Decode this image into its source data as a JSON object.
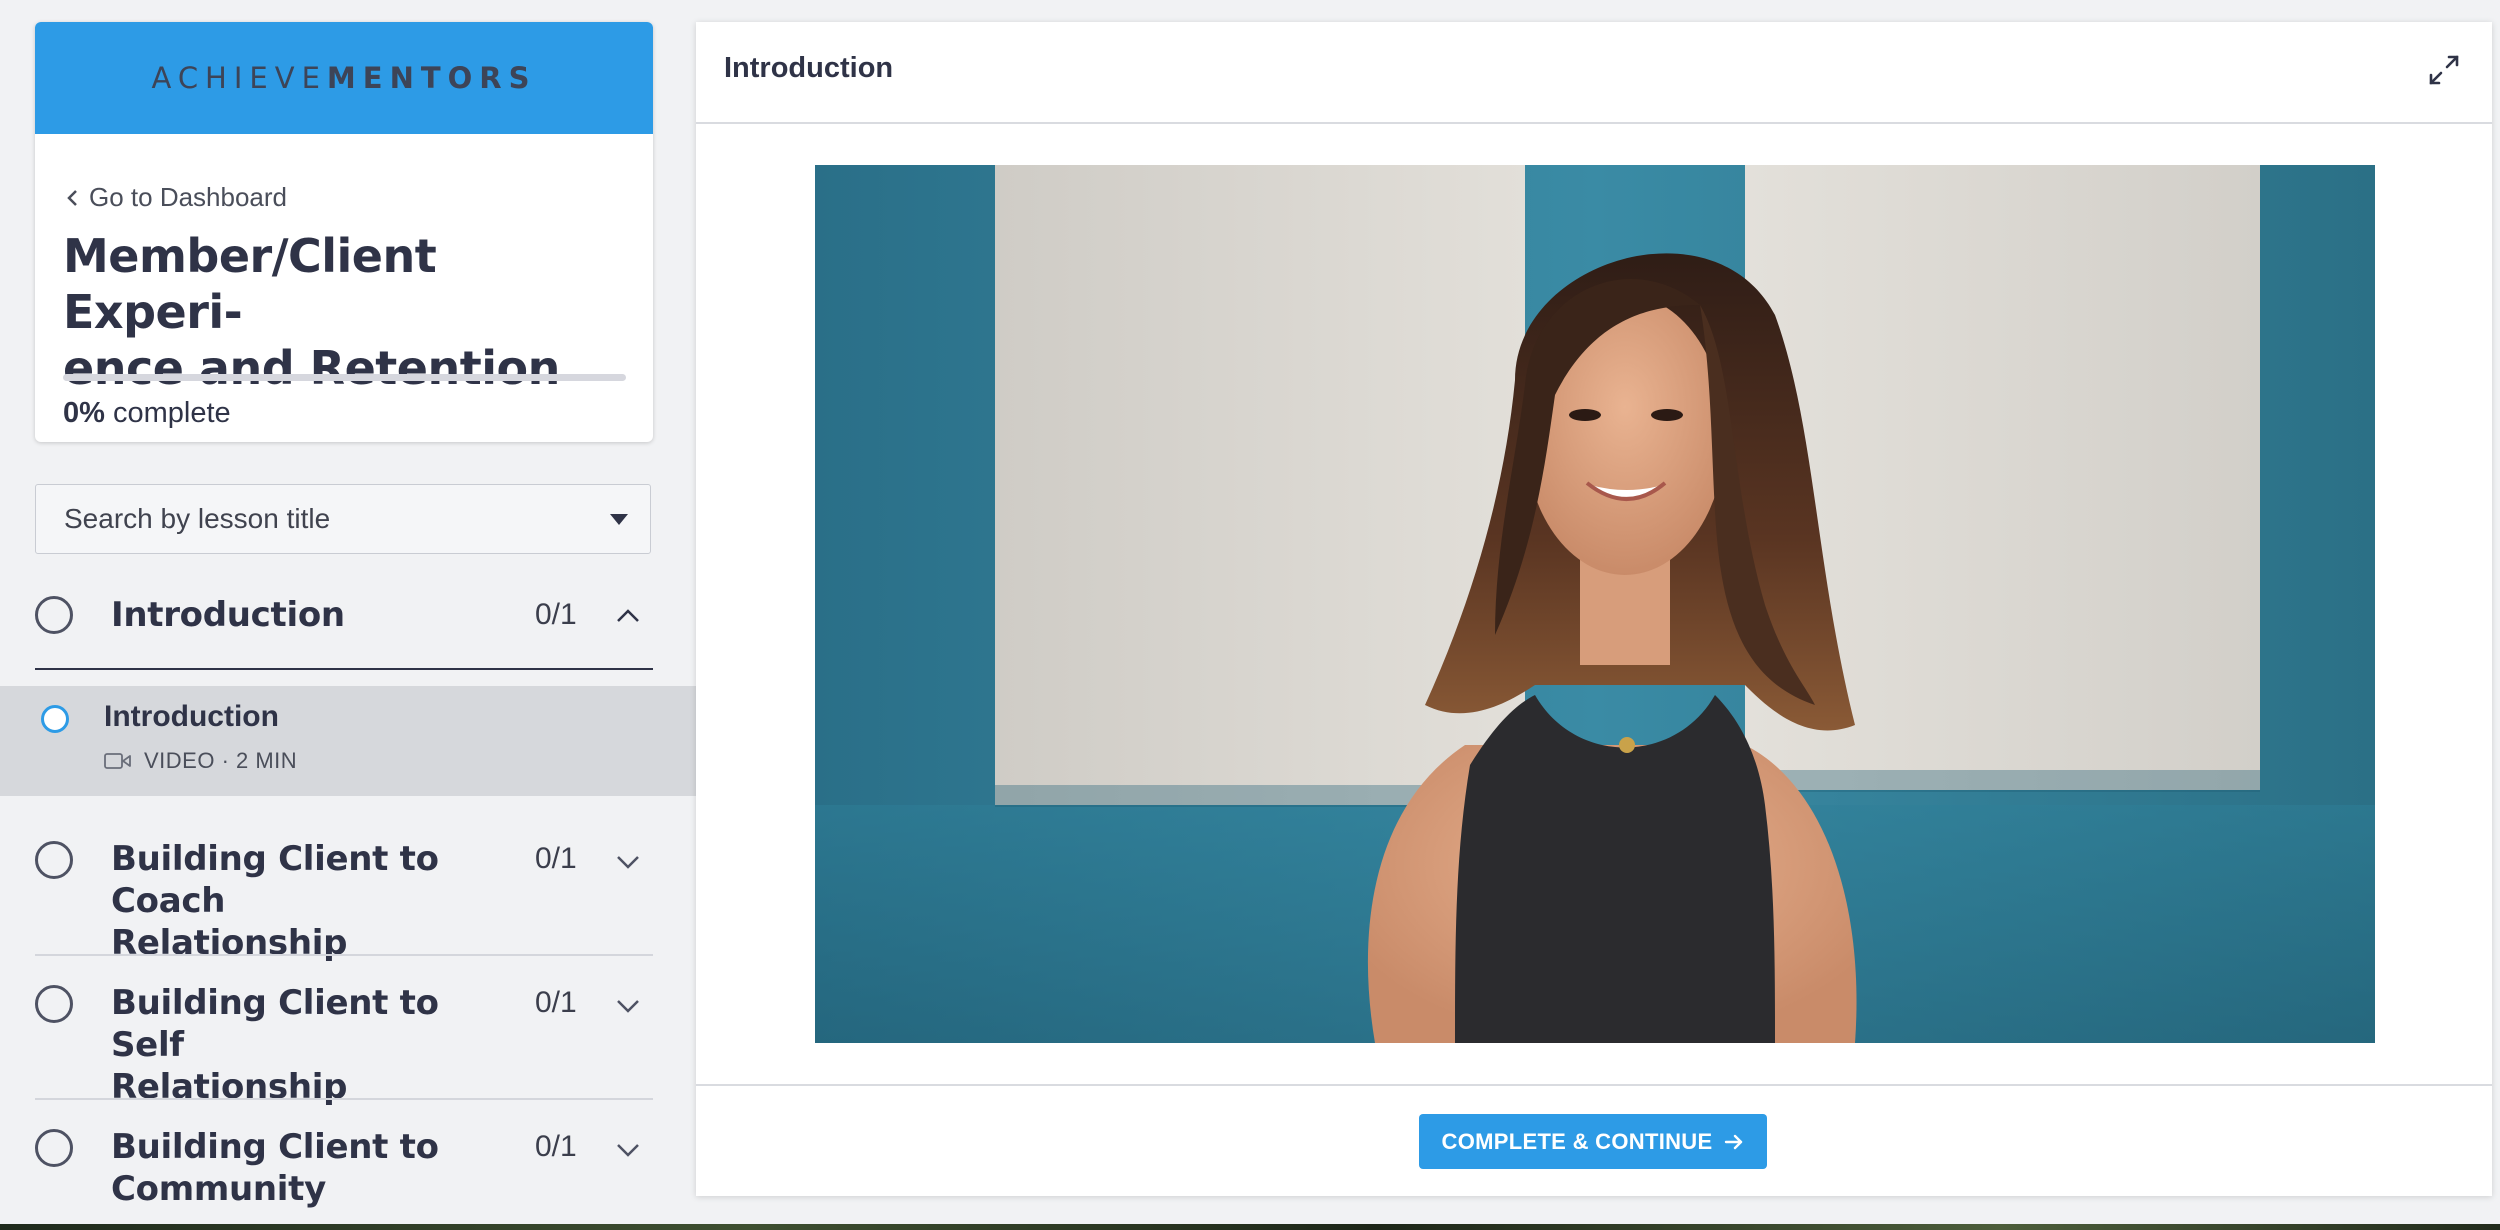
{
  "brand": {
    "part1": "ACHIEVE",
    "part2": "MENTORS",
    "bar_color": "#2d9be6"
  },
  "course": {
    "back_label": "Go to Dashboard",
    "title_line1": "Member/Client Experi-",
    "title_line2": "ence and Retention",
    "progress_percent": 0,
    "progress_value": "0%",
    "progress_suffix": "complete"
  },
  "search": {
    "placeholder": "Search by lesson title"
  },
  "chapters": [
    {
      "title_line1": "Introduction",
      "title_line2": "",
      "count": "0/1",
      "expanded": true
    },
    {
      "title_line1": "Building Client to Coach",
      "title_line2": "Relationship",
      "count": "0/1",
      "expanded": false
    },
    {
      "title_line1": "Building Client to Self",
      "title_line2": "Relationship",
      "count": "0/1",
      "expanded": false
    },
    {
      "title_line1": "Building Client to",
      "title_line2": "Community",
      "count": "0/1",
      "expanded": false
    }
  ],
  "active_lesson": {
    "title": "Introduction",
    "meta": "VIDEO · 2 MIN",
    "icon": "video-camera-icon"
  },
  "main": {
    "title": "Introduction",
    "expand_icon": "expand-arrows-icon",
    "cta_label": "COMPLETE & CONTINUE",
    "cta_icon": "arrow-right-icon"
  },
  "colors": {
    "accent": "#2d9be6",
    "text": "#2f3347",
    "video_wall": "#2f7f97"
  }
}
